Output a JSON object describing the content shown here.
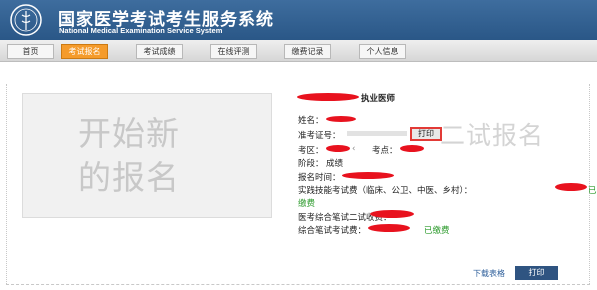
{
  "header": {
    "title": "国家医学考试考生服务系统",
    "subtitle": "National Medical Examination Service System",
    "logo_icon": "medical-emblem-icon"
  },
  "nav": {
    "items": [
      "首页",
      "考试报名",
      "考试成绩",
      "在线评测",
      "缴费记录",
      "个人信息"
    ],
    "active_index": 1
  },
  "placeholder": {
    "line1": "开始新",
    "line2": "的报名"
  },
  "watermark": "二试报名",
  "info": {
    "title": "执业医师",
    "name_label": "姓名：",
    "exam_number_label": "准考证号：",
    "print_label": "打印",
    "exam_area_label": "考区：",
    "exam_site_label": "考点：",
    "stage_label": "阶段：",
    "stage_value": "成绩",
    "reg_time_label": "报名时间：",
    "practical_fee_label": "实践技能考试费（临床、公卫、中医、乡村）：",
    "practical_fee_status_part1": "已",
    "practical_fee_status_part2": "缴费",
    "written_second_fee_label": "医考综合笔试二试收费：",
    "written_fee_label": "综合笔试考试费：",
    "written_fee_status": "已缴费"
  },
  "footer": {
    "download_label": "下载表格",
    "print_label": "打印"
  },
  "colors": {
    "header": "#2a5787",
    "active_tab": "#f59b2b",
    "redaction": "#e8121e",
    "paid": "#2b9a2b"
  }
}
